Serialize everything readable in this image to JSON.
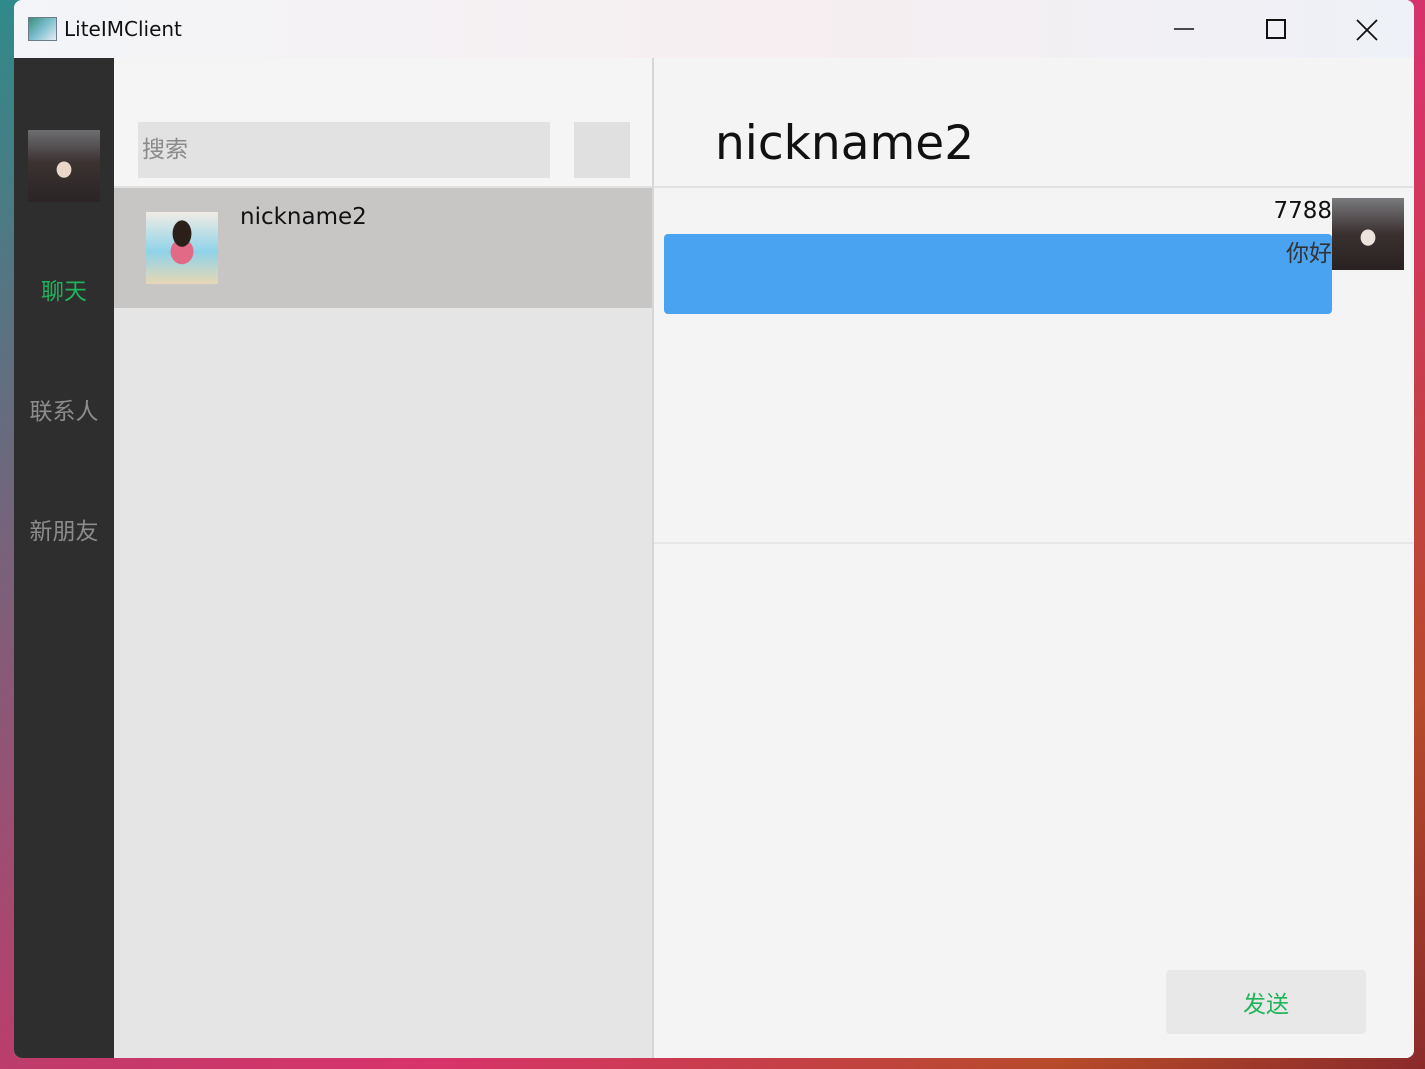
{
  "window": {
    "title": "LiteIMClient"
  },
  "nav": {
    "items": [
      {
        "label": "聊天",
        "active": true
      },
      {
        "label": "联系人",
        "active": false
      },
      {
        "label": "新朋友",
        "active": false
      }
    ]
  },
  "search": {
    "placeholder": "搜索",
    "value": ""
  },
  "conversations": [
    {
      "name": "nickname2"
    }
  ],
  "chat": {
    "title": "nickname2",
    "messages": [
      {
        "sender": "7788",
        "text": "你好"
      }
    ]
  },
  "send_button": {
    "label": "发送"
  },
  "colors": {
    "accent_green": "#1fb35b",
    "bubble_blue": "#4aa3f0",
    "nav_bg": "#2e2e2e"
  }
}
